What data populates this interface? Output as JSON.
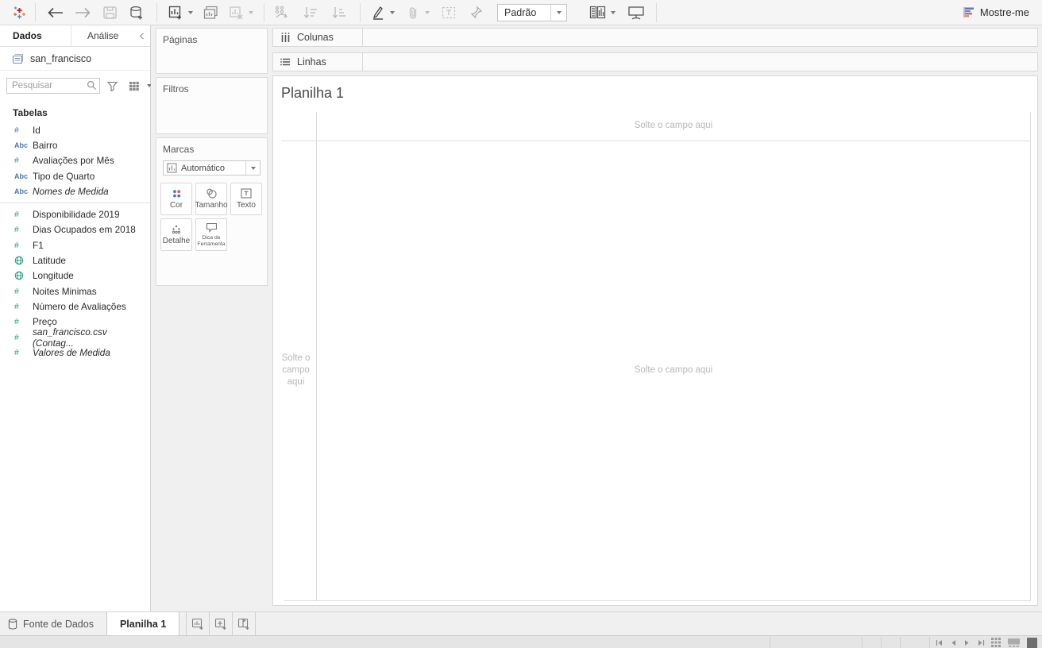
{
  "toolbar": {
    "fit_label": "Padrão",
    "show_me_label": "Mostre-me"
  },
  "sidebar": {
    "tabs": [
      {
        "label": "Dados"
      },
      {
        "label": "Análise"
      }
    ],
    "datasource_name": "san_francisco",
    "search_placeholder": "Pesquisar",
    "tables_header": "Tabelas",
    "fields": [
      {
        "label": "Id",
        "glyph": "#",
        "icon": "number-icon",
        "role": "dimension"
      },
      {
        "label": "Bairro",
        "glyph": "Abc",
        "icon": "text-icon",
        "role": "dimension"
      },
      {
        "label": "Avaliações por Mês",
        "glyph": "#",
        "icon": "number-icon",
        "role": "measure"
      },
      {
        "label": "Tipo de Quarto",
        "glyph": "Abc",
        "icon": "text-icon",
        "role": "dimension"
      },
      {
        "label": "Nomes de Medida",
        "glyph": "Abc",
        "icon": "text-icon",
        "role": "dimension"
      },
      {
        "label": "Disponibilidade 2019",
        "glyph": "#",
        "icon": "number-icon",
        "role": "measure"
      },
      {
        "label": "Dias Ocupados em 2018",
        "glyph": "#",
        "icon": "number-icon",
        "role": "measure"
      },
      {
        "label": "F1",
        "glyph": "#",
        "icon": "number-icon",
        "role": "measure"
      },
      {
        "label": "Latitude",
        "glyph": "",
        "icon": "globe-icon",
        "role": "measure"
      },
      {
        "label": "Longitude",
        "glyph": "",
        "icon": "globe-icon",
        "role": "measure"
      },
      {
        "label": "Noites Minimas",
        "glyph": "#",
        "icon": "number-icon",
        "role": "measure"
      },
      {
        "label": "Número de Avaliações",
        "glyph": "#",
        "icon": "number-icon",
        "role": "measure"
      },
      {
        "label": "Preço",
        "glyph": "#",
        "icon": "number-icon",
        "role": "measure"
      },
      {
        "label": "san_francisco.csv (Contag...",
        "glyph": "#",
        "icon": "number-icon",
        "role": "measure"
      },
      {
        "label": "Valores de Medida",
        "glyph": "#",
        "icon": "number-icon",
        "role": "measure"
      }
    ]
  },
  "cards": {
    "pages_label": "Páginas",
    "filters_label": "Filtros",
    "marks": {
      "label": "Marcas",
      "mark_type": "Automático",
      "buttons": [
        "Cor",
        "Tamanho",
        "Texto",
        "Detalhe",
        "Dica de Ferramenta"
      ]
    }
  },
  "shelves": {
    "columns_label": "Colunas",
    "rows_label": "Linhas"
  },
  "canvas": {
    "sheet_title": "Planilha 1",
    "drop_hint": "Solte o campo aqui"
  },
  "bottom": {
    "datasource_tab": "Fonte de Dados",
    "sheet_tab": "Planilha 1"
  },
  "colors": {
    "dimension_blue": "#4e79a7",
    "measure_green": "#2e9c85",
    "showme_blue": "#5b74b8",
    "showme_red": "#d65a57",
    "toolbar_bg": "#f5f5f5",
    "panel_bg": "#f0f0f0"
  }
}
